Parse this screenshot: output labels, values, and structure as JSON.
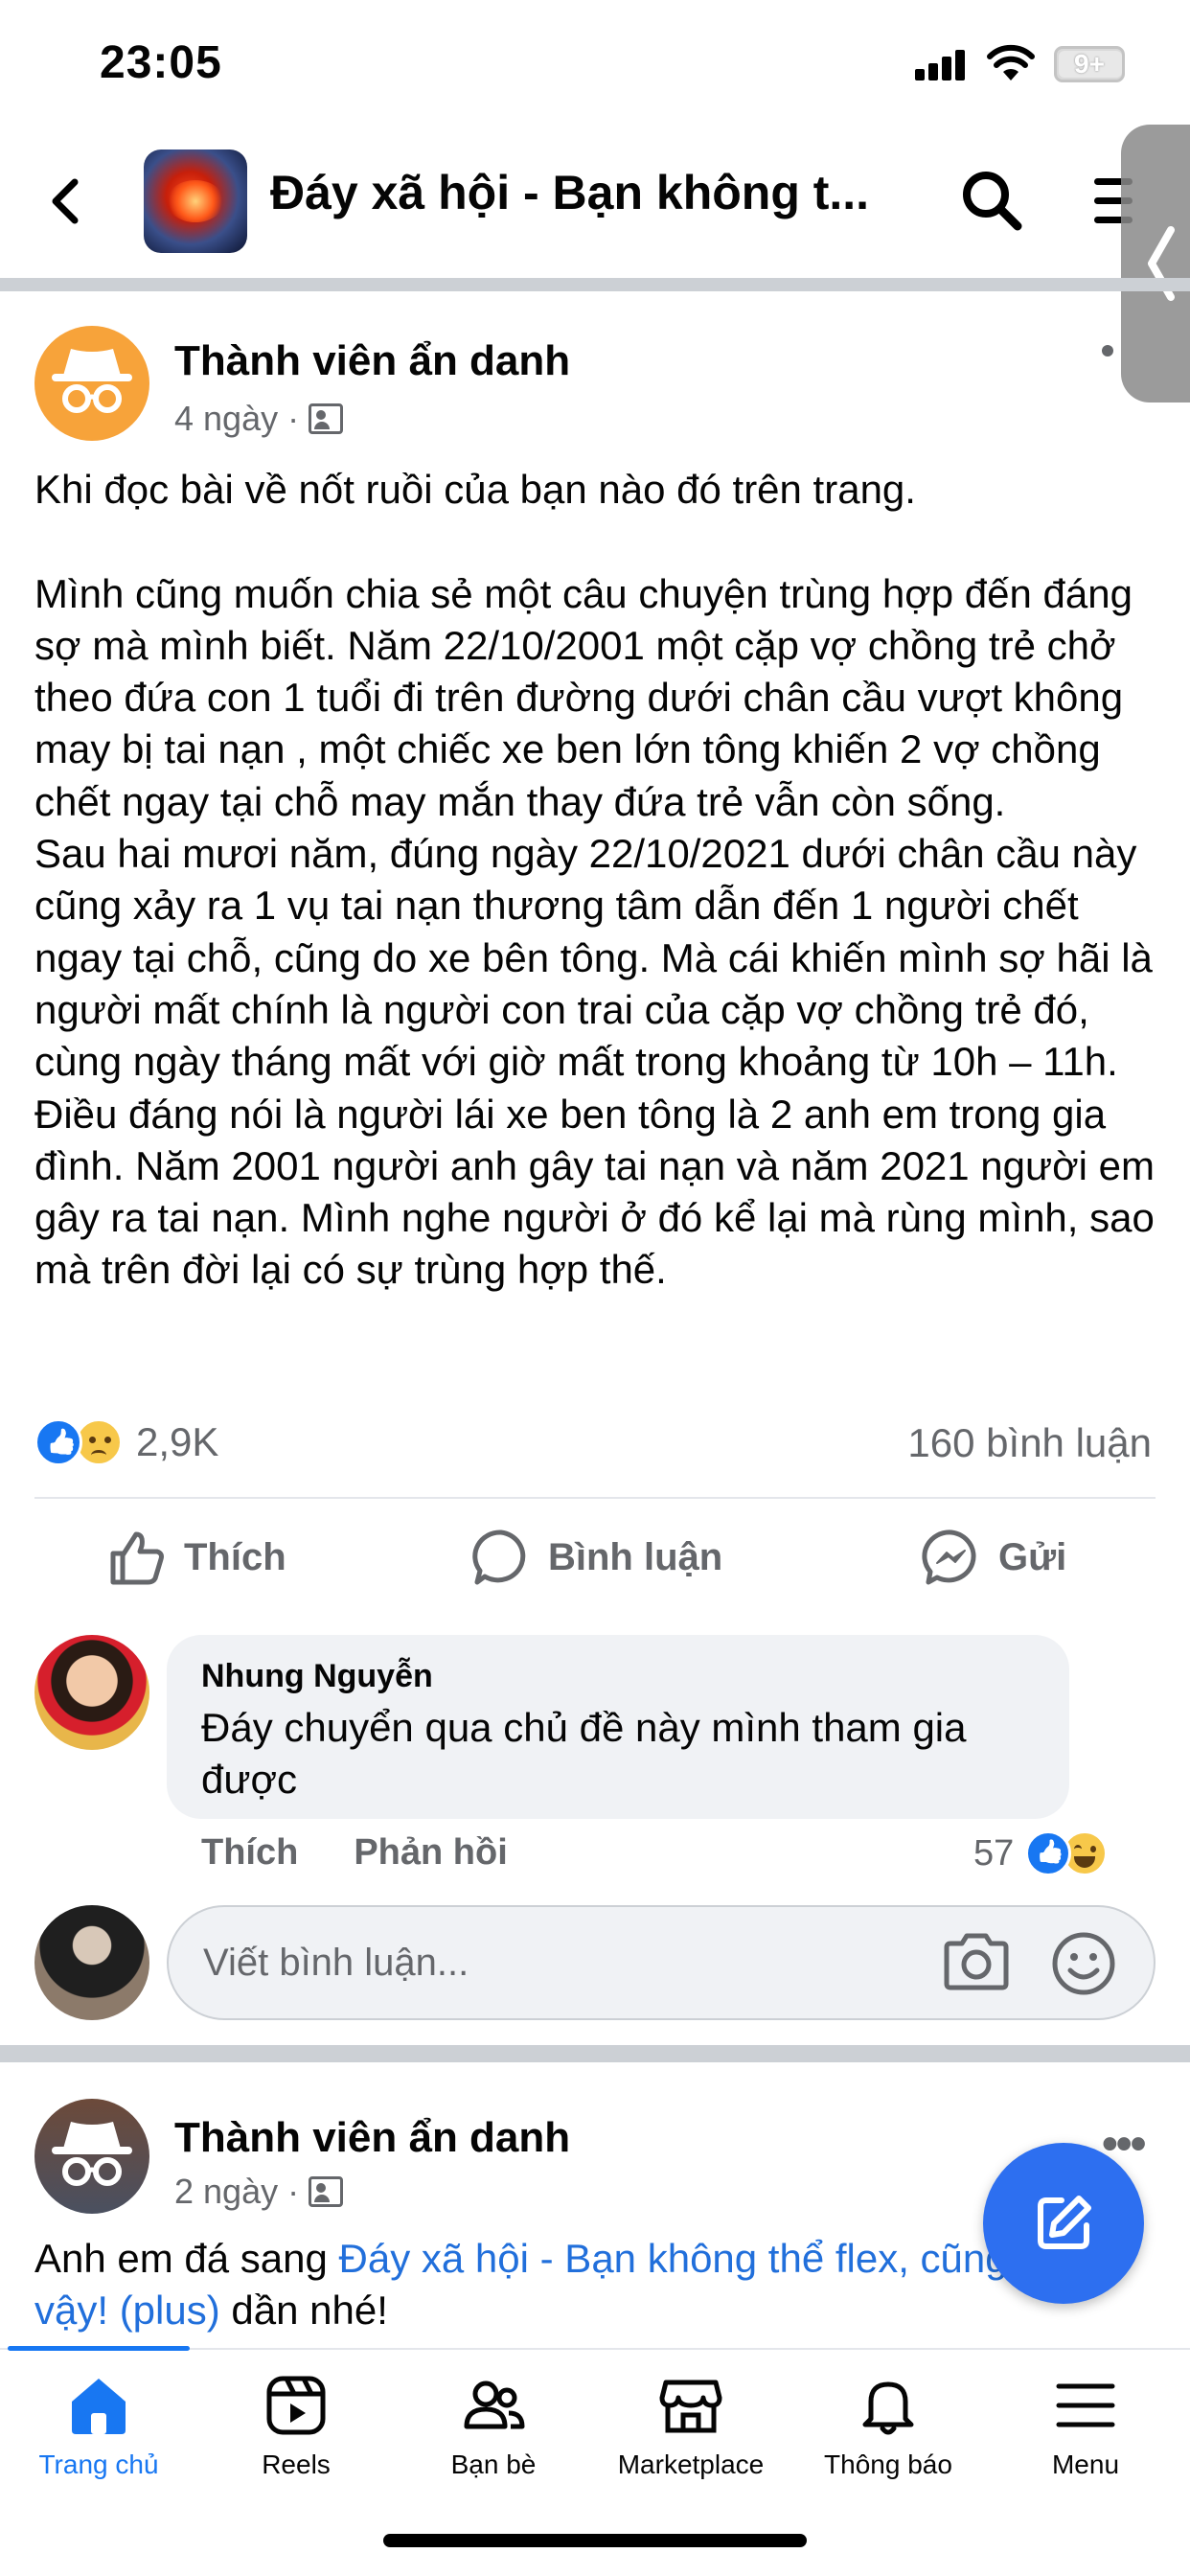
{
  "status_bar": {
    "time": "23:05",
    "battery": "9+"
  },
  "header": {
    "group_title": "Đáy xã hội - Bạn không t..."
  },
  "post": {
    "author": "Thành viên ẩn danh",
    "time": "4 ngày",
    "separator": "·",
    "body": "Khi đọc bài về nốt ruồi của bạn nào đó trên trang.\n\nMình cũng muốn chia sẻ một câu chuyện trùng hợp đến đáng sợ mà mình biết. Năm 22/10/2001 một cặp vợ chồng trẻ chở theo đứa con 1 tuổi đi trên đường dưới chân cầu vượt không may bị tai nạn , một chiếc xe ben lớn tông khiến 2 vợ chồng chết ngay tại chỗ may mắn thay đứa trẻ vẫn còn sống.\nSau hai mươi năm, đúng ngày 22/10/2021 dưới chân cầu này cũng xảy ra 1 vụ tai nạn thương tâm dẫn đến 1 người chết ngay tại chỗ, cũng do xe bên tông. Mà cái khiến mình sợ hãi là người mất chính là người con trai của cặp vợ chồng trẻ đó, cùng ngày tháng mất với giờ mất trong khoảng từ 10h – 11h. Điều đáng nói là người lái xe ben tông là 2 anh em trong gia đình. Năm 2001 người anh gây tai nạn và năm 2021 người em gây ra tai nạn. Mình nghe người ở đó kể lại mà rùng mình, sao mà trên đời lại có sự trùng hợp thế.",
    "reaction_count": "2,9K",
    "comment_count": "160 bình luận",
    "actions": {
      "like": "Thích",
      "comment": "Bình luận",
      "share": "Gửi"
    }
  },
  "comment": {
    "author": "Nhung Nguyễn",
    "text": "Đáy chuyển qua chủ đề này mình tham gia được",
    "like": "Thích",
    "reply": "Phản hồi",
    "reaction_count": "57"
  },
  "write_comment": {
    "placeholder": "Viết bình luận..."
  },
  "post2": {
    "author": "Thành viên ẩn danh",
    "time": "2 ngày",
    "separator": "·",
    "body_prefix": "Anh em đá sang ",
    "link_text": "Đáy xã hội - Bạn không thể flex, cũng vậy! (plus)",
    "body_suffix": " dần nhé!"
  },
  "tab_bar": {
    "tabs": [
      {
        "label": "Trang chủ",
        "icon": "home-icon",
        "active": true
      },
      {
        "label": "Reels",
        "icon": "reels-icon"
      },
      {
        "label": "Bạn bè",
        "icon": "friends-icon"
      },
      {
        "label": "Marketplace",
        "icon": "marketplace-icon"
      },
      {
        "label": "Thông báo",
        "icon": "bell-icon"
      },
      {
        "label": "Menu",
        "icon": "menu-icon"
      }
    ]
  },
  "colors": {
    "accent": "#1877f2",
    "secondary_text": "#65676b",
    "link": "#216fdb",
    "fab": "#2d6ff0"
  }
}
